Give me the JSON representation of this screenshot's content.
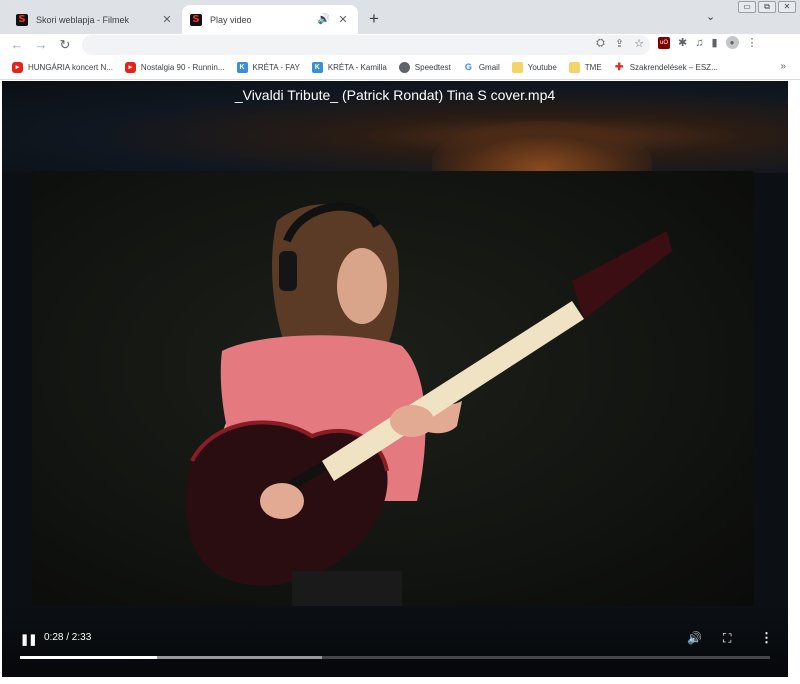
{
  "tabs": [
    {
      "title": "Skori weblapja - Filmek",
      "favicon": "S",
      "active": false
    },
    {
      "title": "Play video",
      "favicon": "S",
      "active": true
    }
  ],
  "icons": {
    "new_tab": "+",
    "tab_close": "✕",
    "audio": "🔊",
    "dropdown": "⌄",
    "minimize": "▭",
    "restore": "⧉",
    "close": "✕",
    "back": "←",
    "forward": "→",
    "reload": "↻",
    "translate": "⛭",
    "share": "⇪",
    "star": "☆",
    "extensions": "✱",
    "media": "♫",
    "sidepanel": "▮",
    "profile": "●",
    "menu": "⋮",
    "more_bookmarks": "»"
  },
  "omnibox": {
    "url": ""
  },
  "extensions": {
    "ublock_label": "uO"
  },
  "bookmarks": [
    {
      "label": "HUNGÁRIA koncert N...",
      "icon": "youtube-icon"
    },
    {
      "label": "Nostalgia 90 - Runnin...",
      "icon": "youtube-icon"
    },
    {
      "label": "KRÉTA - FAY",
      "icon": "kreta-icon"
    },
    {
      "label": "KRÉTA - Kamilla",
      "icon": "kreta-icon"
    },
    {
      "label": "Speedtest",
      "icon": "globe-icon"
    },
    {
      "label": "Gmail",
      "icon": "google-icon"
    },
    {
      "label": "Youtube",
      "icon": "folder-icon"
    },
    {
      "label": "TME",
      "icon": "folder-icon"
    },
    {
      "label": "Szakrendelések – ESZ...",
      "icon": "medical-cross-icon"
    }
  ],
  "video": {
    "title": "_Vivaldi Tribute_ (Patrick Rondat) Tina S cover.mp4",
    "time_display": "0:28 / 2:33",
    "played_fraction": 0.183,
    "buffered_fraction": 0.402
  }
}
